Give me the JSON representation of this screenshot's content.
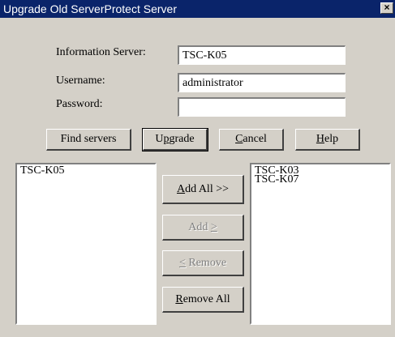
{
  "window": {
    "title": "Upgrade Old ServerProtect Server",
    "close_glyph": "×"
  },
  "form": {
    "info_server_label": "Information Server:",
    "info_server_value": "TSC-K05",
    "username_label": "Username:",
    "username_value": "administrator",
    "password_label": "Password:",
    "password_value": ""
  },
  "buttons": {
    "find_servers": "Find servers",
    "upgrade": {
      "pre": "U",
      "key": "p",
      "post": "grade"
    },
    "cancel": {
      "pre": "",
      "key": "C",
      "post": "ancel"
    },
    "help": {
      "pre": "",
      "key": "H",
      "post": "elp"
    },
    "add_all": {
      "pre": "",
      "key": "A",
      "post": "dd All >>"
    },
    "add": {
      "pre": "Add ",
      "key": ">",
      "post": ""
    },
    "remove": {
      "pre": "",
      "key": "<",
      "post": " Remove"
    },
    "remove_all": {
      "pre": "",
      "key": "R",
      "post": "emove All"
    }
  },
  "left_list": {
    "items": [
      "TSC-K05"
    ]
  },
  "right_list": {
    "items": [
      "TSC-K03",
      "TSC-K07"
    ]
  }
}
